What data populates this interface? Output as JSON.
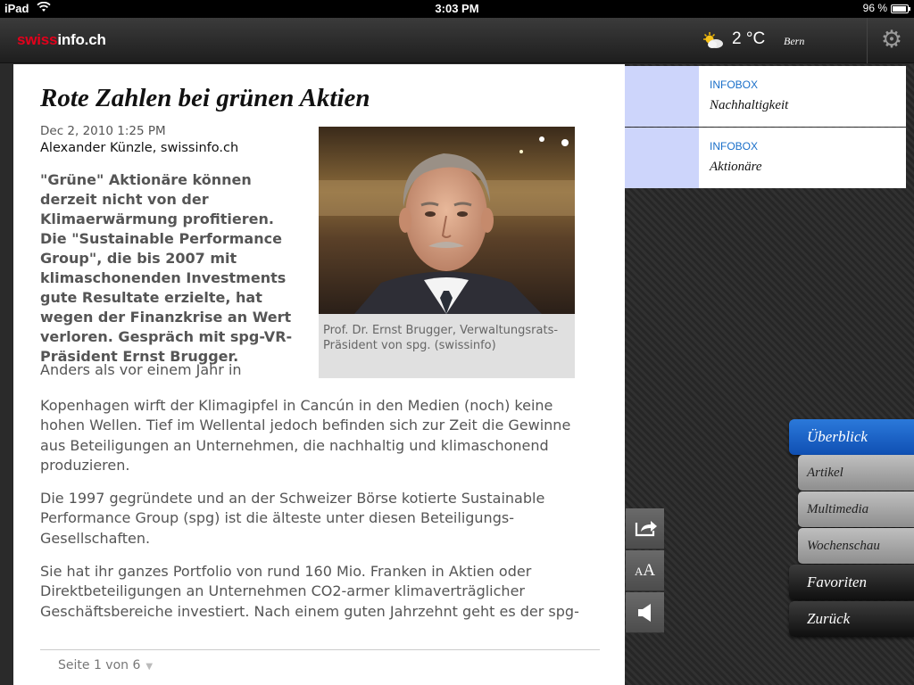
{
  "status_bar": {
    "device": "iPad",
    "time": "3:03 PM",
    "battery": "96 %",
    "battery_level": 0.96
  },
  "header": {
    "logo_red": "swiss",
    "logo_white": "info.ch",
    "temperature": "2 °C",
    "city": "Bern",
    "weather_icon": "partly-cloudy-icon",
    "settings_icon": "gear-icon"
  },
  "article": {
    "title": "Rote Zahlen bei grünen Aktien",
    "date": "Dec 2, 2010 1:25 PM",
    "author": "Alexander Künzle, swissinfo.ch",
    "lead": "\"Grüne\" Aktionäre können derzeit nicht von der Klimaerwärmung profitieren. Die \"Sustainable Performance Group\", die bis 2007 mit klimaschonenden Investments gute Resultate erzielte, hat wegen der Finanzkrise an Wert verloren. Gespräch mit spg-VR-Präsident Ernst Brugger.",
    "first_line": "Anders als vor einem Jahr in",
    "paragraphs": [
      "Kopenhagen wirft der Klimagipfel in Cancún in den Medien (noch) keine hohen Wellen. Tief im Wellental jedoch befinden sich zur Zeit die Gewinne aus Beteiligungen an Unternehmen, die nachhaltig und klimaschonend produzieren.",
      "Die 1997 gegründete und an der Schweizer Börse kotierte Sustainable Performance Group (spg) ist die älteste unter diesen Beteiligungs-Gesellschaften.",
      "Sie hat ihr ganzes Portfolio von rund 160 Mio. Franken in Aktien oder Direktbeteiligungen an Unternehmen CO2-armer klimaverträglicher Geschäftsbereiche investiert. Nach einem guten Jahrzehnt geht es der spg-"
    ],
    "photo_caption": "Prof. Dr. Ernst Brugger, Verwaltungsrats-Präsident von spg. (swissinfo)",
    "pager": "Seite 1 von 6"
  },
  "infoboxes": [
    {
      "tag": "INFOBOX",
      "label": "Nachhaltigkeit"
    },
    {
      "tag": "INFOBOX",
      "label": "Aktionäre"
    }
  ],
  "tools": {
    "share_icon": "share-icon",
    "font_small": "A",
    "font_big": "A",
    "audio_icon": "speaker-icon"
  },
  "nav": {
    "ueberblick": "Überblick",
    "artikel": "Artikel",
    "multimedia": "Multimedia",
    "wochenschau": "Wochenschau",
    "favoriten": "Favoriten",
    "zurueck": "Zurück"
  },
  "colors": {
    "brand_red": "#e3001b",
    "accent_blue": "#1a6fc9",
    "nav_active": "#1b63c6"
  }
}
